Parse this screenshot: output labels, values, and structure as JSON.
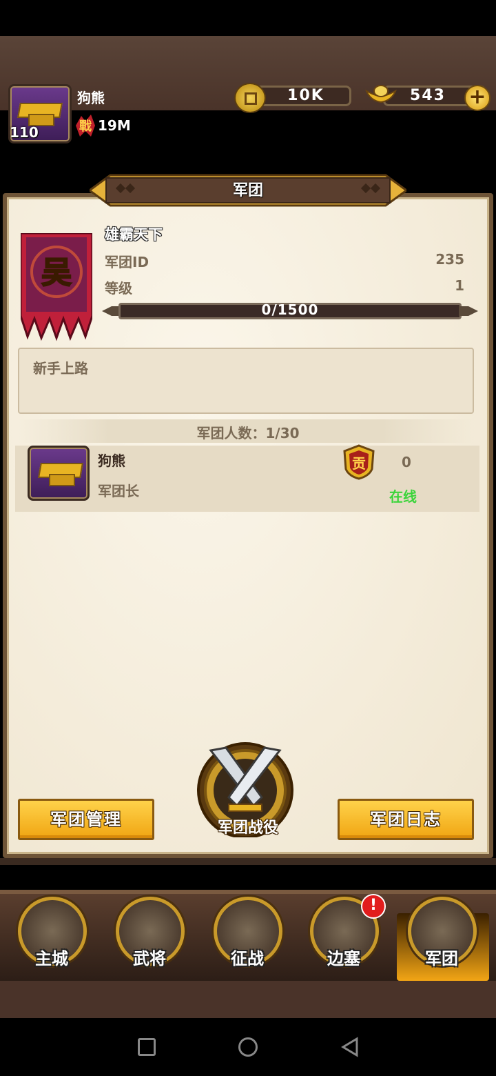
{
  "player": {
    "name": "狗熊",
    "level": "110",
    "power": "19M"
  },
  "resources": {
    "coins": "10K",
    "ingots": "543"
  },
  "window": {
    "title": "军团"
  },
  "guild": {
    "name": "雄霸天下",
    "banner_char": "吴",
    "id_label": "军团ID",
    "id_value": "235",
    "level_label": "等级",
    "level_value": "1",
    "xp_text": "0/1500",
    "xp_progress": 0,
    "notice": "新手上路",
    "member_count_text": "军团人数：1/30"
  },
  "members": [
    {
      "name": "狗熊",
      "role": "军团长",
      "contribution": "0",
      "contribution_badge": "贡",
      "status": "在线"
    }
  ],
  "actions": {
    "manage": "军团管理",
    "battle": "军团战役",
    "log": "军团日志"
  },
  "bottom_tabs": [
    {
      "label": "主城",
      "icon": "city-icon"
    },
    {
      "label": "武将",
      "icon": "general-icon"
    },
    {
      "label": "征战",
      "icon": "campaign-icon"
    },
    {
      "label": "边塞",
      "icon": "frontier-icon",
      "badge": "!"
    },
    {
      "label": "军团",
      "icon": "legion-icon",
      "active": true
    }
  ],
  "colors": {
    "online": "#3bd43b",
    "button": "#f0a512",
    "banner": "#c0203a"
  }
}
